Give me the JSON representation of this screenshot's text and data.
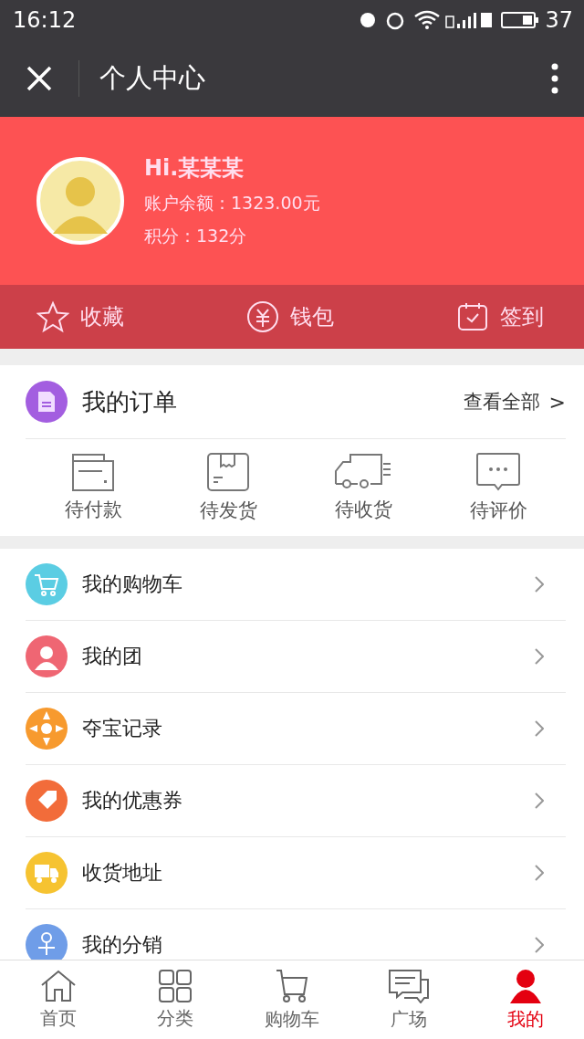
{
  "status_bar": {
    "time": "16:12",
    "battery": "37"
  },
  "header": {
    "title": "个人中心"
  },
  "profile": {
    "greeting": "Hi.某某某",
    "balance": "账户余额：1323.00元",
    "points": "积分：132分"
  },
  "quick_actions": [
    {
      "kind": "star",
      "label": "收藏"
    },
    {
      "kind": "wallet",
      "label": "钱包"
    },
    {
      "kind": "checkin",
      "label": "签到"
    }
  ],
  "orders": {
    "title": "我的订单",
    "view_all": "查看全部",
    "chevron": ">",
    "statuses": [
      {
        "kind": "card",
        "label": "待付款"
      },
      {
        "kind": "box",
        "label": "待发货"
      },
      {
        "kind": "truck",
        "label": "待收货"
      },
      {
        "kind": "comment",
        "label": "待评价"
      }
    ]
  },
  "menu": [
    {
      "kind": "cart",
      "label": "我的购物车",
      "color": "#5bcde3"
    },
    {
      "kind": "group",
      "label": "我的团",
      "color": "#ef6673"
    },
    {
      "kind": "wheel",
      "label": "夺宝记录",
      "color": "#f79a2e"
    },
    {
      "kind": "tag",
      "label": "我的优惠券",
      "color": "#f26c3a"
    },
    {
      "kind": "truck",
      "label": "收货地址",
      "color": "#f6c331"
    },
    {
      "kind": "person",
      "label": "我的分销",
      "color": "#6f9de8"
    }
  ],
  "tab_bar": [
    {
      "kind": "home",
      "label": "首页",
      "selected": false
    },
    {
      "kind": "grid",
      "label": "分类",
      "selected": false
    },
    {
      "kind": "cart",
      "label": "购物车",
      "selected": false
    },
    {
      "kind": "chat",
      "label": "广场",
      "selected": false
    },
    {
      "kind": "user",
      "label": "我的",
      "selected": true
    }
  ]
}
